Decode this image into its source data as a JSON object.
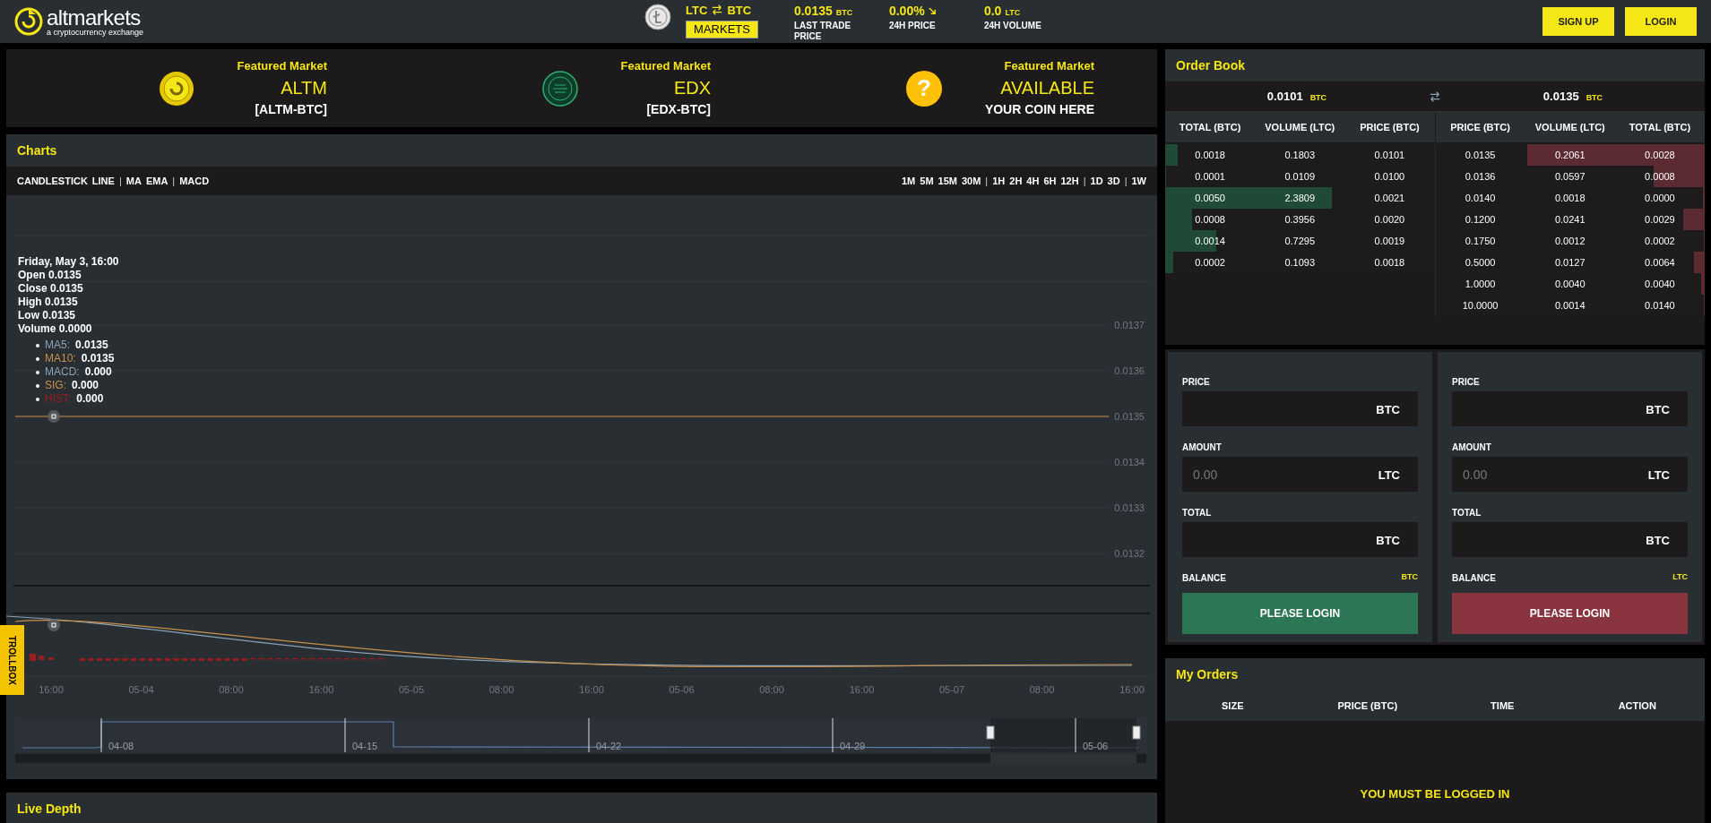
{
  "header": {
    "logo": {
      "name": "altmarkets",
      "tagline": "a cryptocurrency exchange"
    },
    "pair": {
      "base": "LTC",
      "quote": "BTC",
      "button": "MARKETS"
    },
    "stats": [
      {
        "value": "0.0135",
        "unit": "BTC",
        "label": "LAST TRADE PRICE",
        "kind": "plain"
      },
      {
        "value": "0.00%",
        "label": "24H PRICE",
        "kind": "trend"
      },
      {
        "value": "0.0",
        "unit": "LTC",
        "label": "24H VOLUME",
        "kind": "plain"
      }
    ],
    "buttons": [
      "SIGN UP",
      "LOGIN"
    ]
  },
  "featured": [
    {
      "heading": "Featured Market",
      "name": "ALTM",
      "pair": "[ALTM-BTC]",
      "kind": "altm"
    },
    {
      "heading": "Featured Market",
      "name": "EDX",
      "pair": "[EDX-BTC]",
      "kind": "edx"
    },
    {
      "heading": "Featured Market",
      "name": "AVAILABLE",
      "pair": "YOUR COIN HERE",
      "kind": "question",
      "icon": "?"
    }
  ],
  "charts": {
    "title": "Charts",
    "toolbar_left": [
      {
        "label": "CANDLESTICK",
        "kind": "option"
      },
      {
        "label": "LINE",
        "kind": "option"
      },
      {
        "label": "|",
        "kind": "separator"
      },
      {
        "label": "MA",
        "kind": "option"
      },
      {
        "label": "EMA",
        "kind": "option"
      },
      {
        "label": "|",
        "kind": "separator"
      },
      {
        "label": "MACD",
        "kind": "option"
      }
    ],
    "toolbar_right": [
      {
        "label": "1M",
        "kind": "option"
      },
      {
        "label": "5M",
        "kind": "option"
      },
      {
        "label": "15M",
        "kind": "option"
      },
      {
        "label": "30M",
        "kind": "option"
      },
      {
        "label": "|",
        "kind": "separator"
      },
      {
        "label": "1H",
        "kind": "option"
      },
      {
        "label": "2H",
        "kind": "option"
      },
      {
        "label": "4H",
        "kind": "option"
      },
      {
        "label": "6H",
        "kind": "option"
      },
      {
        "label": "12H",
        "kind": "option"
      },
      {
        "label": "|",
        "kind": "separator"
      },
      {
        "label": "1D",
        "kind": "option"
      },
      {
        "label": "3D",
        "kind": "option"
      },
      {
        "label": "|",
        "kind": "separator"
      },
      {
        "label": "1W",
        "kind": "option"
      }
    ],
    "tooltip": {
      "title": "Friday, May 3, 16:00",
      "lines": [
        "Open 0.0135",
        "Close 0.0135",
        "High 0.0135",
        "Low 0.0135",
        "Volume 0.0000"
      ],
      "series": [
        {
          "name": "MA5:",
          "value": "0.0135",
          "color": "#8aa2b5"
        },
        {
          "name": "MA10:",
          "value": "0.0135",
          "color": "#c9904a"
        },
        {
          "name": "MACD:",
          "value": "0.000",
          "color": "#8aa2b5"
        },
        {
          "name": "SIG:",
          "value": "0.000",
          "color": "#c9904a"
        },
        {
          "name": "HIST:",
          "value": "0.000",
          "color": "#9b1c1c"
        }
      ]
    },
    "x_axis": [
      "16:00",
      "05-04",
      "08:00",
      "16:00",
      "05-05",
      "08:00",
      "16:00",
      "05-06",
      "08:00",
      "16:00",
      "05-07",
      "08:00",
      "16:00"
    ],
    "y_axis": [
      "0.0137",
      "0.0136",
      "0.0135",
      "0.0134",
      "0.0133",
      "0.0132"
    ],
    "navigator": [
      "04-08",
      "04-15",
      "04-22",
      "04-29",
      "05-06"
    ],
    "trollbox": "TROLLBOX"
  },
  "live_depth": {
    "title": "Live Depth"
  },
  "order_book": {
    "title": "Order Book",
    "bid": {
      "value": "0.0101",
      "unit": "BTC"
    },
    "ask": {
      "value": "0.0135",
      "unit": "BTC"
    },
    "bid_columns": [
      "TOTAL (BTC)",
      "VOLUME (LTC)",
      "PRICE (BTC)"
    ],
    "ask_columns": [
      "PRICE (BTC)",
      "VOLUME (LTC)",
      "TOTAL (BTC)"
    ],
    "bids": [
      {
        "total": "0.0018",
        "volume": "0.1803",
        "price": "0.0101",
        "level": 0.046
      },
      {
        "total": "0.0001",
        "volume": "0.0109",
        "price": "0.0100",
        "level": 0.004
      },
      {
        "total": "0.0050",
        "volume": "2.3809",
        "price": "0.0021",
        "level": 0.62
      },
      {
        "total": "0.0008",
        "volume": "0.3956",
        "price": "0.0020",
        "level": 0.1
      },
      {
        "total": "0.0014",
        "volume": "0.7295",
        "price": "0.0019",
        "level": 0.19
      },
      {
        "total": "0.0002",
        "volume": "0.1093",
        "price": "0.0018",
        "level": 0.03
      }
    ],
    "asks": [
      {
        "price": "0.0135",
        "volume": "0.2061",
        "total": "0.0028",
        "level": 0.66
      },
      {
        "price": "0.0136",
        "volume": "0.0597",
        "total": "0.0008",
        "level": 0.19
      },
      {
        "price": "0.0140",
        "volume": "0.0018",
        "total": "0.0000",
        "level": 0.007
      },
      {
        "price": "0.1200",
        "volume": "0.0241",
        "total": "0.0029",
        "level": 0.08
      },
      {
        "price": "0.1750",
        "volume": "0.0012",
        "total": "0.0002",
        "level": 0.004
      },
      {
        "price": "0.5000",
        "volume": "0.0127",
        "total": "0.0064",
        "level": 0.04
      },
      {
        "price": "1.0000",
        "volume": "0.0040",
        "total": "0.0040",
        "level": 0.013
      },
      {
        "price": "10.0000",
        "volume": "0.0014",
        "total": "0.0140",
        "level": 0.003
      }
    ]
  },
  "trade_forms": [
    {
      "kind": "buy",
      "fields": [
        {
          "label": "PRICE",
          "unit": "BTC"
        },
        {
          "label": "AMOUNT",
          "placeholder": "0.00",
          "unit": "LTC"
        },
        {
          "label": "TOTAL",
          "unit": "BTC"
        }
      ],
      "balance_label": "BALANCE",
      "balance_unit": "BTC",
      "button": "PLEASE LOGIN"
    },
    {
      "kind": "sell",
      "fields": [
        {
          "label": "PRICE",
          "unit": "BTC"
        },
        {
          "label": "AMOUNT",
          "placeholder": "0.00",
          "unit": "LTC"
        },
        {
          "label": "TOTAL",
          "unit": "BTC"
        }
      ],
      "balance_label": "BALANCE",
      "balance_unit": "LTC",
      "button": "PLEASE LOGIN"
    }
  ],
  "my_orders": {
    "title": "My Orders",
    "columns": [
      "SIZE",
      "PRICE (BTC)",
      "TIME",
      "ACTION"
    ],
    "message": "YOU MUST BE LOGGED IN"
  }
}
